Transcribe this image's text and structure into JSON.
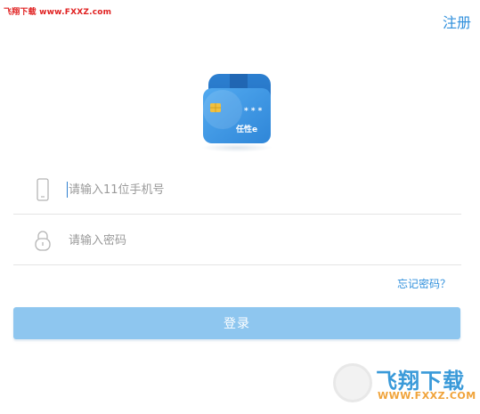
{
  "watermark": {
    "top_left": "飞翔下载 www.FXXZ.com",
    "bottom_right_brand": "飞翔下载",
    "bottom_right_url": "WWW.FXXZ.COM"
  },
  "header": {
    "register_label": "注册"
  },
  "logo": {
    "icon": "credit-card-app-icon",
    "text": "任性e",
    "card_stars": "* * *",
    "colors": {
      "dark": "#1d5fae",
      "mid": "#2f86d8",
      "light": "#4aa3ea"
    }
  },
  "form": {
    "phone": {
      "icon": "phone-icon",
      "placeholder": "请输入11位手机号",
      "value": ""
    },
    "password": {
      "icon": "lock-icon",
      "placeholder": "请输入密码",
      "value": ""
    },
    "forgot_label": "忘记密码？",
    "login_label": "登录"
  },
  "colors": {
    "accent": "#2f8fdc",
    "button": "#8ec6ef",
    "watermark_red": "#e02020"
  }
}
